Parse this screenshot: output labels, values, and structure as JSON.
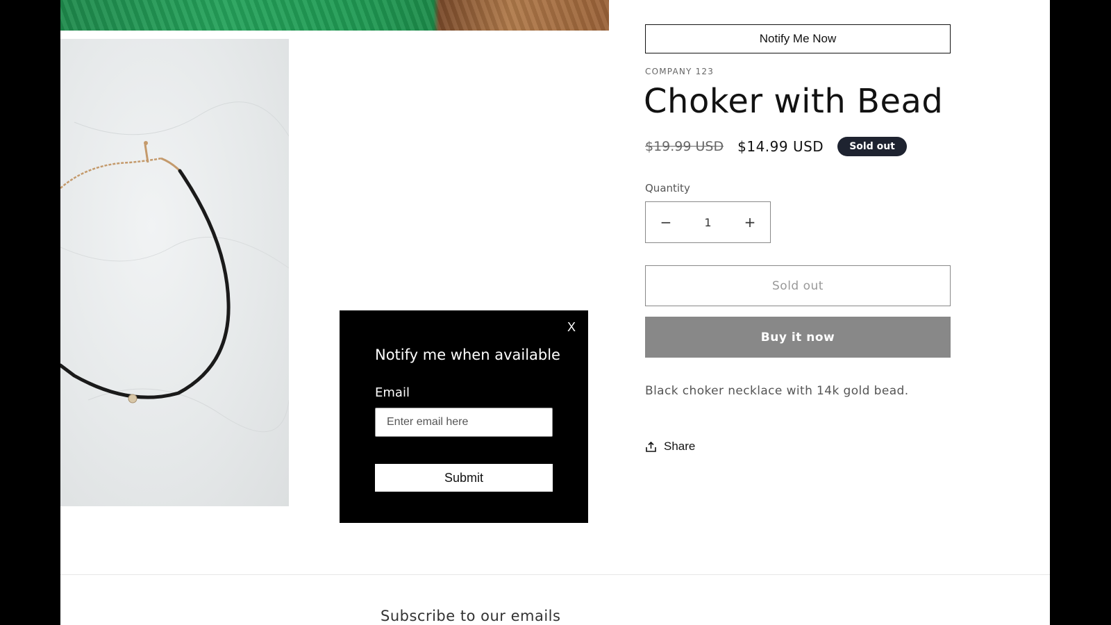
{
  "popup": {
    "close_label": "X",
    "title": "Notify me when available",
    "email_label": "Email",
    "email_placeholder": "Enter email here",
    "submit_label": "Submit"
  },
  "product": {
    "notify_button": "Notify Me Now",
    "vendor": "COMPANY 123",
    "title": "Choker with Bead",
    "price_regular": "$19.99 USD",
    "price_sale": "$14.99 USD",
    "badge": "Sold out",
    "quantity_label": "Quantity",
    "quantity_value": "1",
    "quantity_minus": "−",
    "quantity_plus": "+",
    "sold_out_button": "Sold out",
    "buy_now_button": "Buy it now",
    "description": "Black choker necklace with 14k gold bead.",
    "share_label": "Share"
  },
  "footer": {
    "subscribe_heading": "Subscribe to our emails"
  },
  "colors": {
    "badge_bg": "#1e2330",
    "buy_button_bg": "#888888",
    "popup_bg": "#000000"
  }
}
